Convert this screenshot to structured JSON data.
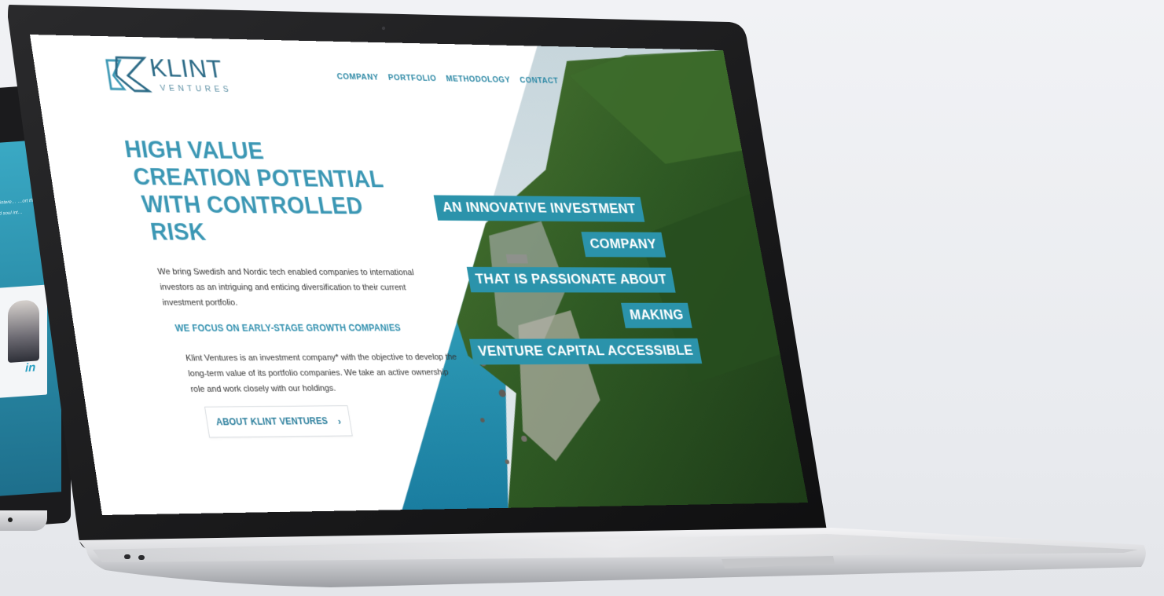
{
  "site": {
    "logo": {
      "word": "KLINT",
      "sub": "VENTURES",
      "brand_color": "#2b6a86",
      "accent_color": "#3b97b4"
    },
    "nav": [
      {
        "label": "COMPANY"
      },
      {
        "label": "PORTFOLIO"
      },
      {
        "label": "METHODOLOGY"
      },
      {
        "label": "CONTACT"
      }
    ],
    "headline": [
      "HIGH VALUE",
      "CREATION POTENTIAL",
      "WITH CONTROLLED",
      "RISK"
    ],
    "intro": "We bring Swedish and Nordic tech enabled companies to international investors as an intriguing and enticing diversification to their current investment portfolio.",
    "focus": "WE FOCUS ON EARLY-STAGE GROWTH COMPANIES",
    "body": "Klint Ventures is an investment company* with the objective to develop the long-term value of its portfolio companies. We take an active ownership role and work closely with our holdings.",
    "about_button": {
      "label": "ABOUT KLINT VENTURES",
      "icon": "chevron-right-icon"
    },
    "tagline": [
      "AN INNOVATIVE INVESTMENT",
      "COMPANY",
      "THAT IS PASSIONATE ABOUT",
      "MAKING",
      "VENTURE CAPITAL ACCESSIBLE"
    ],
    "tag_color": "#2b93ab"
  },
  "back_screen": {
    "paragraph": "…ing the intere… …ort the manag… …eart and soul int…",
    "linkedin_icon": "linkedin-icon",
    "linkedin_text": "in"
  }
}
